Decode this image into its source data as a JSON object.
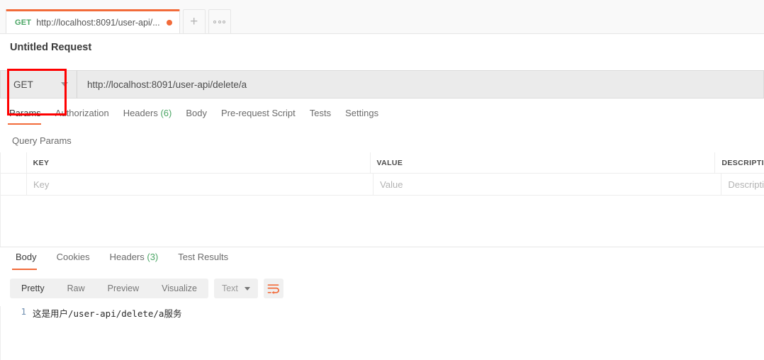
{
  "tabstrip": {
    "request_tab": {
      "method": "GET",
      "url_short": "http://localhost:8091/user-api/...",
      "unsaved_indicator": "unsaved-dot"
    },
    "new_tab_label": "+",
    "more_label": "more-options-icon"
  },
  "request": {
    "title": "Untitled Request",
    "method": "GET",
    "method_caret": "chevron-down-icon",
    "url": "http://localhost:8091/user-api/delete/a",
    "tabs": [
      {
        "label": "Params",
        "count": "",
        "active": true
      },
      {
        "label": "Authorization",
        "count": "",
        "active": false
      },
      {
        "label": "Headers",
        "count": "(6)",
        "active": false
      },
      {
        "label": "Body",
        "count": "",
        "active": false
      },
      {
        "label": "Pre-request Script",
        "count": "",
        "active": false
      },
      {
        "label": "Tests",
        "count": "",
        "active": false
      },
      {
        "label": "Settings",
        "count": "",
        "active": false
      }
    ],
    "query_params_label": "Query Params",
    "table": {
      "headers": [
        "",
        "KEY",
        "VALUE",
        "DESCRIPTI"
      ],
      "rows": [
        {
          "key": "Key",
          "value": "Value",
          "description": "Descripti"
        }
      ]
    }
  },
  "response": {
    "tabs": [
      {
        "label": "Body",
        "count": "",
        "active": true
      },
      {
        "label": "Cookies",
        "count": "",
        "active": false
      },
      {
        "label": "Headers",
        "count": "(3)",
        "active": false
      },
      {
        "label": "Test Results",
        "count": "",
        "active": false
      }
    ],
    "view_modes": [
      {
        "label": "Pretty",
        "active": true
      },
      {
        "label": "Raw",
        "active": false
      },
      {
        "label": "Preview",
        "active": false
      },
      {
        "label": "Visualize",
        "active": false
      }
    ],
    "format": "Text",
    "format_caret": "chevron-down-icon",
    "wrap_icon": "wrap-text-icon",
    "body_lines": [
      {
        "number": "1",
        "text": "这是用户/user-api/delete/a服务"
      }
    ]
  },
  "annotation": {
    "highlight_target": "method-dropdown",
    "color": "#ff0000"
  },
  "colors": {
    "accent": "#f26b3a",
    "method_get": "#4aa564",
    "count_green": "#4aa564",
    "annotation_red": "#ff0000"
  }
}
